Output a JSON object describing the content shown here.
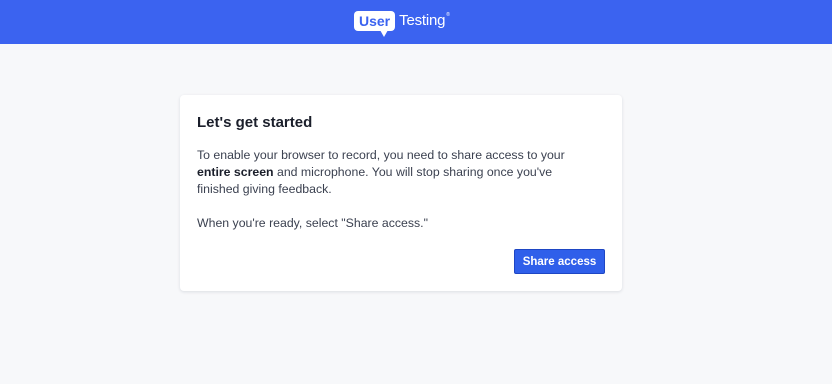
{
  "header": {
    "logo_part1": "User",
    "logo_part2": "Testing",
    "logo_tm": "®",
    "bg_color": "#3b63f0"
  },
  "card": {
    "title": "Let's get started",
    "body_text_1": "To enable your browser to record, you need to share access to your ",
    "body_bold_1": "entire screen",
    "body_text_2": " and microphone. You will stop sharing once you've finished giving feedback.",
    "body_paragraph_2": "When you're ready, select \"Share access.\"",
    "share_button_label": "Share access"
  },
  "colors": {
    "accent": "#2f5fea",
    "page_background": "#f7f8fa"
  }
}
